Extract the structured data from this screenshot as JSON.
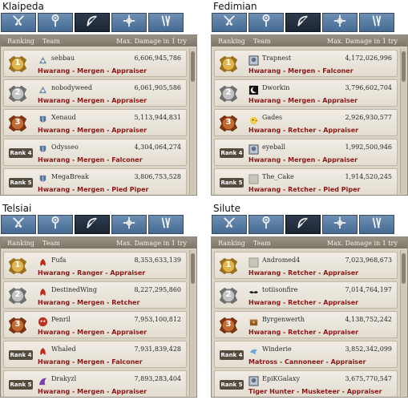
{
  "header_labels": {
    "ranking": "Ranking",
    "team": "Team",
    "damage": "Max. Damage in 1 try"
  },
  "rank_prefix": "Rank",
  "panels": [
    {
      "server": "Klaipeda",
      "rows": [
        {
          "rank": "1",
          "name": "sebbau",
          "damage": "6,606,945,786",
          "jobs": "Hwarang - Mergen - Appraiser",
          "icon": "bird-helm-icon"
        },
        {
          "rank": "2",
          "name": "nobodyweed",
          "damage": "6,061,905,586",
          "jobs": "Hwarang - Mergen - Appraiser",
          "icon": "bird-helm-icon"
        },
        {
          "rank": "3",
          "name": "Xenaud",
          "damage": "5,113,944,831",
          "jobs": "Hwarang - Mergen - Appraiser",
          "icon": "armor-icon"
        },
        {
          "rank": "4",
          "name": "Odysseo",
          "damage": "4,304,064,274",
          "jobs": "Hwarang - Mergen - Falconer",
          "icon": "armor-icon"
        },
        {
          "rank": "5",
          "name": "MegaBreak",
          "damage": "3,806,753,528",
          "jobs": "Hwarang - Mergen - Pied Piper",
          "icon": "armor-icon"
        }
      ]
    },
    {
      "server": "Fedimian",
      "rows": [
        {
          "rank": "1",
          "name": "Trapnest",
          "damage": "4,172,026,996",
          "jobs": "Hwarang - Mergen - Falconer",
          "icon": "portrait-icon"
        },
        {
          "rank": "2",
          "name": "Dworkin",
          "damage": "3,796,602,704",
          "jobs": "Hwarang - Mergen - Appraiser",
          "icon": "moon-icon"
        },
        {
          "rank": "3",
          "name": "Gades",
          "damage": "2,926,930,577",
          "jobs": "Hwarang - Retcher - Appraiser",
          "icon": "chick-icon"
        },
        {
          "rank": "4",
          "name": "eyeball",
          "damage": "1,992,500,946",
          "jobs": "Hwarang - Mergen - Appraiser",
          "icon": "portrait-icon"
        },
        {
          "rank": "5",
          "name": "The_Cake",
          "damage": "1,914,520,245",
          "jobs": "Hwarang - Retcher - Pied Piper",
          "icon": "blank-icon"
        }
      ]
    },
    {
      "server": "Telsiai",
      "rows": [
        {
          "rank": "1",
          "name": "Fufa",
          "damage": "8,353,633,139",
          "jobs": "Hwarang - Ranger - Appraiser",
          "icon": "phoenix-icon"
        },
        {
          "rank": "2",
          "name": "DestinedWing",
          "damage": "8,227,295,860",
          "jobs": "Hwarang - Mergen - Retcher",
          "icon": "phoenix-icon"
        },
        {
          "rank": "3",
          "name": "Penril",
          "damage": "7,953,100,812",
          "jobs": "Hwarang - Mergen - Appraiser",
          "icon": "mask-icon"
        },
        {
          "rank": "4",
          "name": "Whaled",
          "damage": "7,931,839,428",
          "jobs": "Hwarang - Mergen - Falconer",
          "icon": "phoenix-icon"
        },
        {
          "rank": "5",
          "name": "Drakyzl",
          "damage": "7,893,283,404",
          "jobs": "Hwarang - Mergen - Appraiser",
          "icon": "dragon-icon"
        }
      ]
    },
    {
      "server": "Silute",
      "rows": [
        {
          "rank": "1",
          "name": "Andromed4",
          "damage": "7,023,968,673",
          "jobs": "Hwarang - Retcher - Appraiser",
          "icon": "blank-icon"
        },
        {
          "rank": "2",
          "name": "totiisonfire",
          "damage": "7,014,764,197",
          "jobs": "Hwarang - Retcher - Appraiser",
          "icon": "mustache-icon"
        },
        {
          "rank": "3",
          "name": "Byrgenwerth",
          "damage": "4,138,752,242",
          "jobs": "Hwarang - Retcher - Appraiser",
          "icon": "chest-icon"
        },
        {
          "rank": "4",
          "name": "Winderie",
          "damage": "3,852,342,099",
          "jobs": "Matross - Cannoneer - Appraiser",
          "icon": "bird-icon"
        },
        {
          "rank": "5",
          "name": "EpiKGalaxy",
          "damage": "3,675,770,547",
          "jobs": "Tiger Hunter - Musketeer - Appraiser",
          "icon": "portrait-icon"
        }
      ]
    }
  ],
  "tabs": [
    {
      "icon": "swords-icon"
    },
    {
      "icon": "staff-icon"
    },
    {
      "icon": "bow-icon",
      "active": true
    },
    {
      "icon": "cross-icon"
    },
    {
      "icon": "sash-icon"
    }
  ],
  "colors": {
    "job_text": "#8c1717",
    "gold": "#c89a3a",
    "silver": "#a7a7a7",
    "bronze": "#a9582a",
    "tab_blue": "#5b7da3",
    "tab_active": "#253243"
  }
}
